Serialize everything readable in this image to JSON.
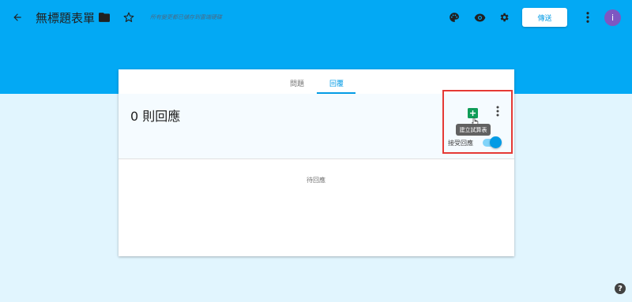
{
  "header": {
    "title": "無標題表單",
    "saved_status": "所有變更都已儲存到雲端硬碟",
    "send_label": "傳送",
    "avatar_initial": "i",
    "icons": [
      "back-arrow-icon",
      "folder-icon",
      "star-icon",
      "palette-icon",
      "eye-icon",
      "gear-icon",
      "more-vert-icon"
    ]
  },
  "tabs": [
    {
      "label": "問題",
      "active": false
    },
    {
      "label": "回覆",
      "active": true
    }
  ],
  "responses": {
    "count_label": "0 則回應",
    "create_sheet_tooltip": "建立試算表",
    "accepting_label": "接受回應",
    "accepting_on": true,
    "empty_text": "待回應"
  },
  "colors": {
    "header_bg": "#03a9f4",
    "page_bg": "#e1f5fe",
    "accent": "#039be5",
    "sheets_green": "#0f9d58",
    "highlight_red": "#e53935",
    "avatar": "#7e57c2"
  }
}
